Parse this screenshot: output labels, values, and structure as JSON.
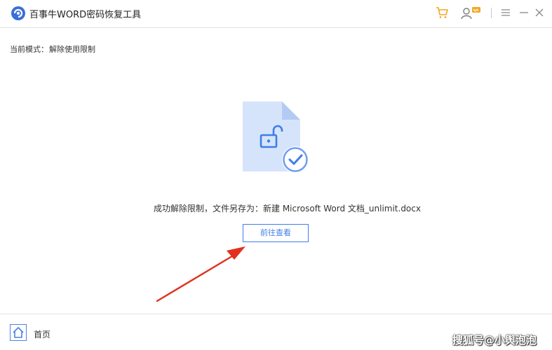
{
  "window": {
    "title": "百事牛WORD密码恢复工具",
    "icons": [
      "app-logo-icon",
      "cart-icon",
      "user-vip-icon",
      "menu-icon",
      "minimize-icon",
      "close-icon"
    ]
  },
  "mode": {
    "label": "当前模式：",
    "value": "解除使用限制"
  },
  "result": {
    "message": "成功解除限制，文件另存为：新建 Microsoft Word 文档_unlimit.docx",
    "button_label": "前往查看"
  },
  "footer": {
    "home_label": "首页"
  },
  "watermark": "搜狐号@小舆泡泡",
  "colors": {
    "accent": "#3f7ee8",
    "file_fill": "#d6e4fb",
    "cart": "#f5a623",
    "arrow": "#e0311f"
  }
}
